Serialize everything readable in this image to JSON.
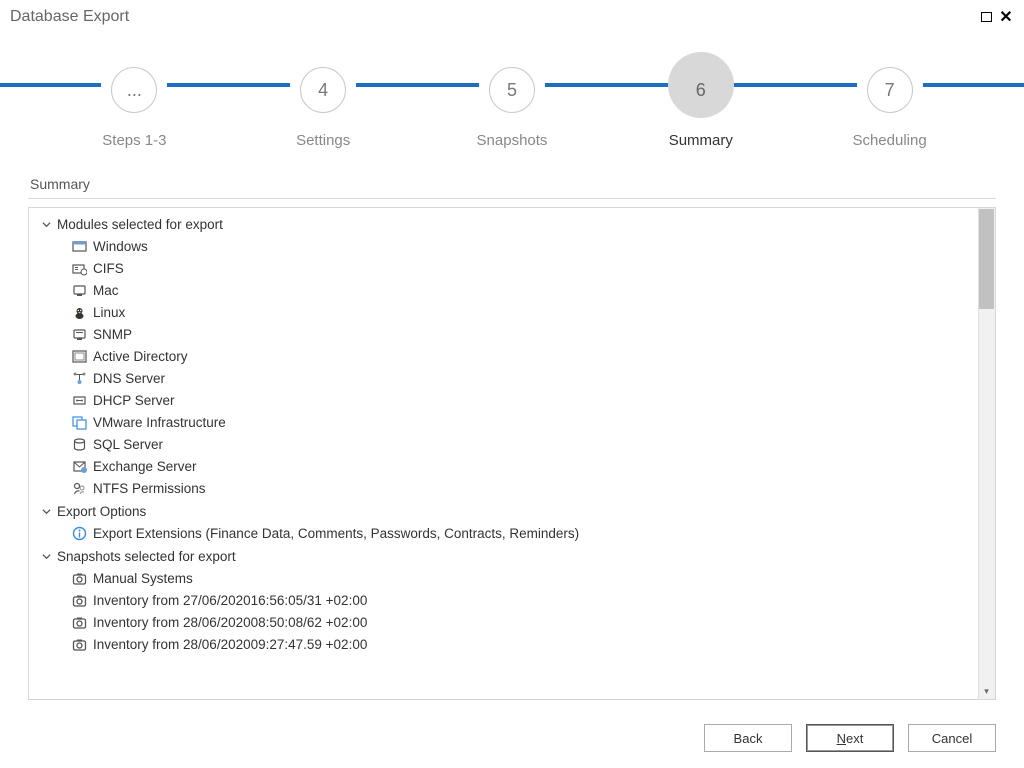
{
  "window": {
    "title": "Database Export"
  },
  "stepper": {
    "steps": [
      {
        "num": "...",
        "label": "Steps 1-3",
        "active": false
      },
      {
        "num": "4",
        "label": "Settings",
        "active": false
      },
      {
        "num": "5",
        "label": "Snapshots",
        "active": false
      },
      {
        "num": "6",
        "label": "Summary",
        "active": true
      },
      {
        "num": "7",
        "label": "Scheduling",
        "active": false
      }
    ]
  },
  "section": {
    "header": "Summary"
  },
  "tree": {
    "groups": [
      {
        "title": "Modules selected for export",
        "items": [
          {
            "label": "Windows",
            "icon": "windows"
          },
          {
            "label": "CIFS",
            "icon": "cifs"
          },
          {
            "label": "Mac",
            "icon": "mac"
          },
          {
            "label": "Linux",
            "icon": "linux"
          },
          {
            "label": "SNMP",
            "icon": "snmp"
          },
          {
            "label": "Active Directory",
            "icon": "ad"
          },
          {
            "label": "DNS Server",
            "icon": "dns"
          },
          {
            "label": "DHCP Server",
            "icon": "dhcp"
          },
          {
            "label": "VMware Infrastructure",
            "icon": "vmware"
          },
          {
            "label": "SQL Server",
            "icon": "sql"
          },
          {
            "label": "Exchange Server",
            "icon": "exchange"
          },
          {
            "label": "NTFS Permissions",
            "icon": "ntfs"
          }
        ]
      },
      {
        "title": "Export Options",
        "items": [
          {
            "label": "Export Extensions (Finance Data, Comments, Passwords, Contracts, Reminders)",
            "icon": "info"
          }
        ]
      },
      {
        "title": "Snapshots selected for export",
        "items": [
          {
            "label": "Manual Systems",
            "icon": "camera"
          },
          {
            "label": "Inventory from 27/06/202016:56:05/31 +02:00",
            "icon": "camera"
          },
          {
            "label": "Inventory from 28/06/202008:50:08/62 +02:00",
            "icon": "camera"
          },
          {
            "label": "Inventory from 28/06/202009:27:47.59 +02:00",
            "icon": "camera"
          }
        ]
      }
    ]
  },
  "footer": {
    "back": "Back",
    "next_pre": "N",
    "next_post": "ext",
    "cancel": "Cancel"
  }
}
